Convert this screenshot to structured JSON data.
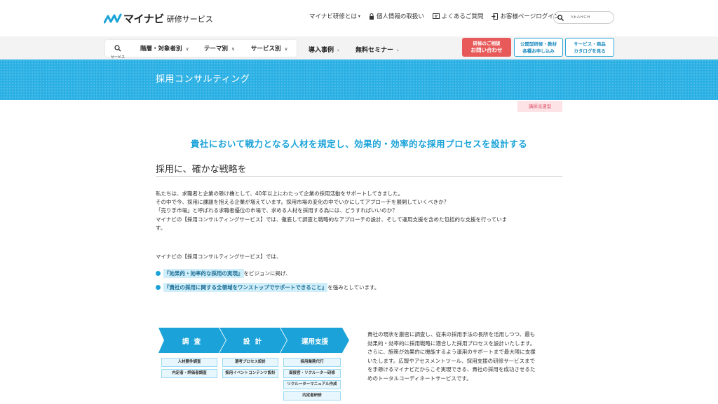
{
  "header": {
    "logo_text": "マイナビ",
    "logo_sub": "研修サービス",
    "util_links": [
      {
        "label": "マイナビ研修とは",
        "icon": "chevron-down-icon"
      },
      {
        "label": "個人情報の取扱い",
        "icon": "lock-icon"
      },
      {
        "label": "よくあるご質問",
        "icon": "book-icon"
      },
      {
        "label": "お客様ページログイン",
        "icon": "login-icon"
      }
    ],
    "search_placeholder": "SEARCH"
  },
  "nav": {
    "search_label": "サービス",
    "dropdowns": [
      "階層・対象者別",
      "テーマ別",
      "サービス別"
    ],
    "links": [
      "導入事例",
      "無料セミナー"
    ],
    "cta_contact": [
      "研修のご相談",
      "お問い合わせ"
    ],
    "cta_apply": [
      "公開型研修・教材",
      "各種お申し込み"
    ],
    "cta_catalog": [
      "サービス・商品",
      "カタログを見る"
    ]
  },
  "banner": {
    "title": "採用コンサルティング"
  },
  "tag": "講師派遣型",
  "headline": "貴社において戦力となる人材を規定し、効果的・効率的な採用プロセスを設計する",
  "section_title": "採用に、確かな戦略を",
  "paragraph": [
    "私たちは、求職者と企業の懸け橋として、40年以上にわたって企業の採用活動をサポートしてきました。",
    "その中で今、採用に課題を抱える企業が増えています。採用市場の変化の中でいかにしてアプローチを展開していくべきか？",
    "「売り手市場」と呼ばれる求職者優位の市場で、求める人材を採用する為には、どうすればいいのか？",
    "マイナビの【採用コンサルティングサービス】では、徹底して調査と戦略的なアプローチの設計、そして運用支援を含めた包括的な支援を行っていま",
    "す。"
  ],
  "intro": "マイナビの【採用コンサルティングサービス】では、",
  "bullets": [
    {
      "highlight": "『効果的・効率的な採用の実現』",
      "rest": "をビジョンに掲げ、"
    },
    {
      "highlight": "『貴社の採用に関する全領域をワンストップでサポートできること』",
      "rest": "を強みとしています。"
    }
  ],
  "diagram": {
    "steps": [
      "調 査",
      "設 計",
      "運用支援"
    ],
    "col1": [
      "人材要件調査",
      "内定者・評価者調査"
    ],
    "col2": [
      "選考プロセス設計",
      "採用イベントコンテンツ設計"
    ],
    "col3": [
      "採用業務代行",
      "面接官・リクルーター研修",
      "リクルーターマニュアル作成",
      "内定者研修"
    ]
  },
  "side_text": [
    "貴社の現状を厳密に調査し、従来の採用手法の長所を活用しつつ、最も",
    "効果的・効率的に採用戦略に適合した採用プロセスを設計いたします。",
    "さらに、施策が効果的に機能するよう運用のサポートまで最大限に支援",
    "いたします。広報やアセスメントツール、採用支援の研修サービスまで",
    "を手懸けるマイナビだからこそ実現できる、貴社の採用を成功させるた",
    "めのトータルコーディネートサービスです。"
  ],
  "colors": {
    "accent": "#1ba3d9",
    "banner": "#2ab0e4",
    "cta_red": "#e85a5a"
  }
}
